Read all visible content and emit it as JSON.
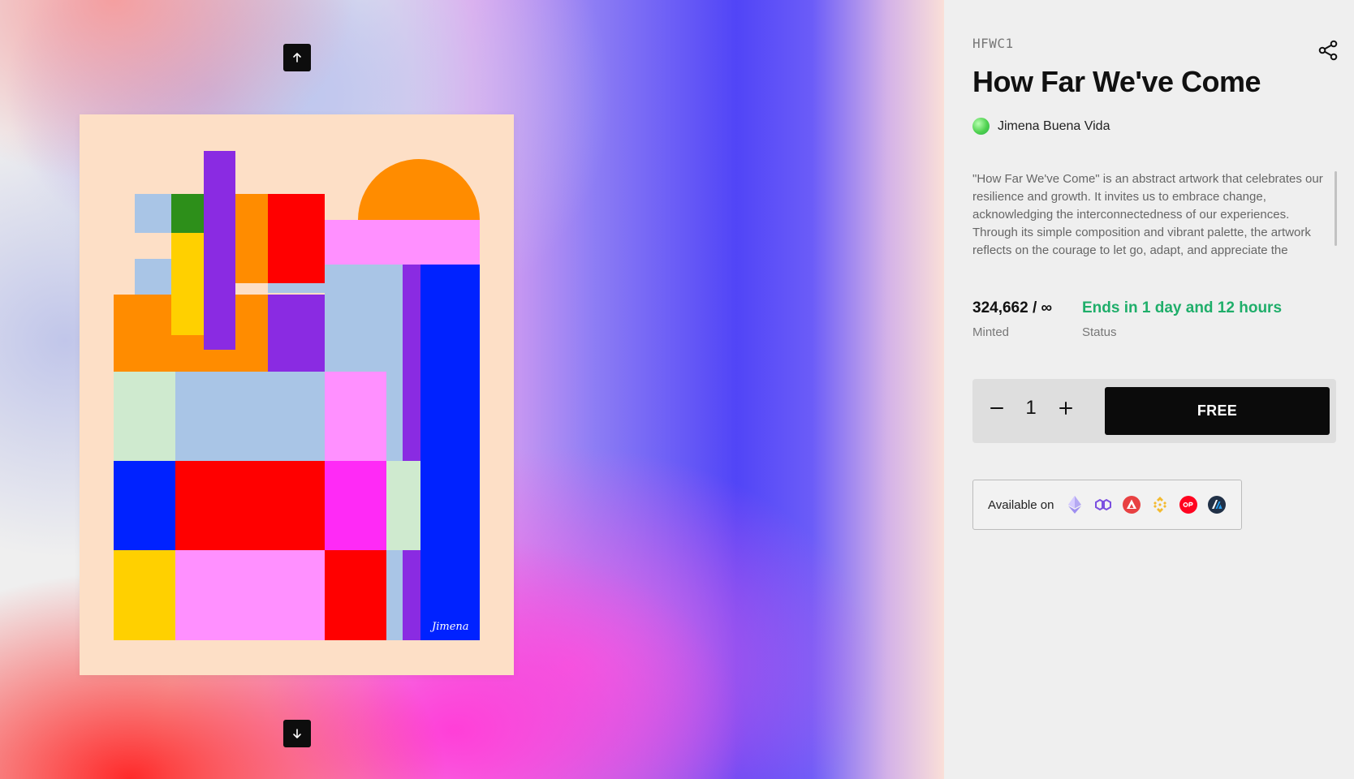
{
  "gallery": {
    "prev_icon": "arrow-up-icon",
    "next_icon": "arrow-down-icon",
    "artwork_signature": "Jimena"
  },
  "details": {
    "code": "HFWC1",
    "title": "How Far We've Come",
    "share_icon": "share-icon",
    "creator": {
      "name": "Jimena Buena Vida"
    },
    "description": "\"How Far We've Come\" is an abstract artwork that celebrates our resilience and growth. It invites us to embrace change, acknowledging the interconnectedness of our experiences. Through its simple composition and vibrant palette, the artwork reflects on the courage to let go, adapt, and appreciate the",
    "minted_value": "324,662 / ∞",
    "minted_label": "Minted",
    "status_value": "Ends in 1 day and 12 hours",
    "status_label": "Status",
    "status_color": "#1fae6a"
  },
  "mint": {
    "decrement_label": "−",
    "quantity": "1",
    "increment_label": "+",
    "button_label": "FREE"
  },
  "availability": {
    "label": "Available on",
    "chains": [
      "ethereum-icon",
      "polygon-icon",
      "avalanche-icon",
      "bnb-icon",
      "optimism-icon",
      "arbitrum-icon"
    ]
  },
  "colors": {
    "panel_bg": "#efefef",
    "button_bg": "#0b0b0b",
    "accent_green": "#1fae6a"
  }
}
